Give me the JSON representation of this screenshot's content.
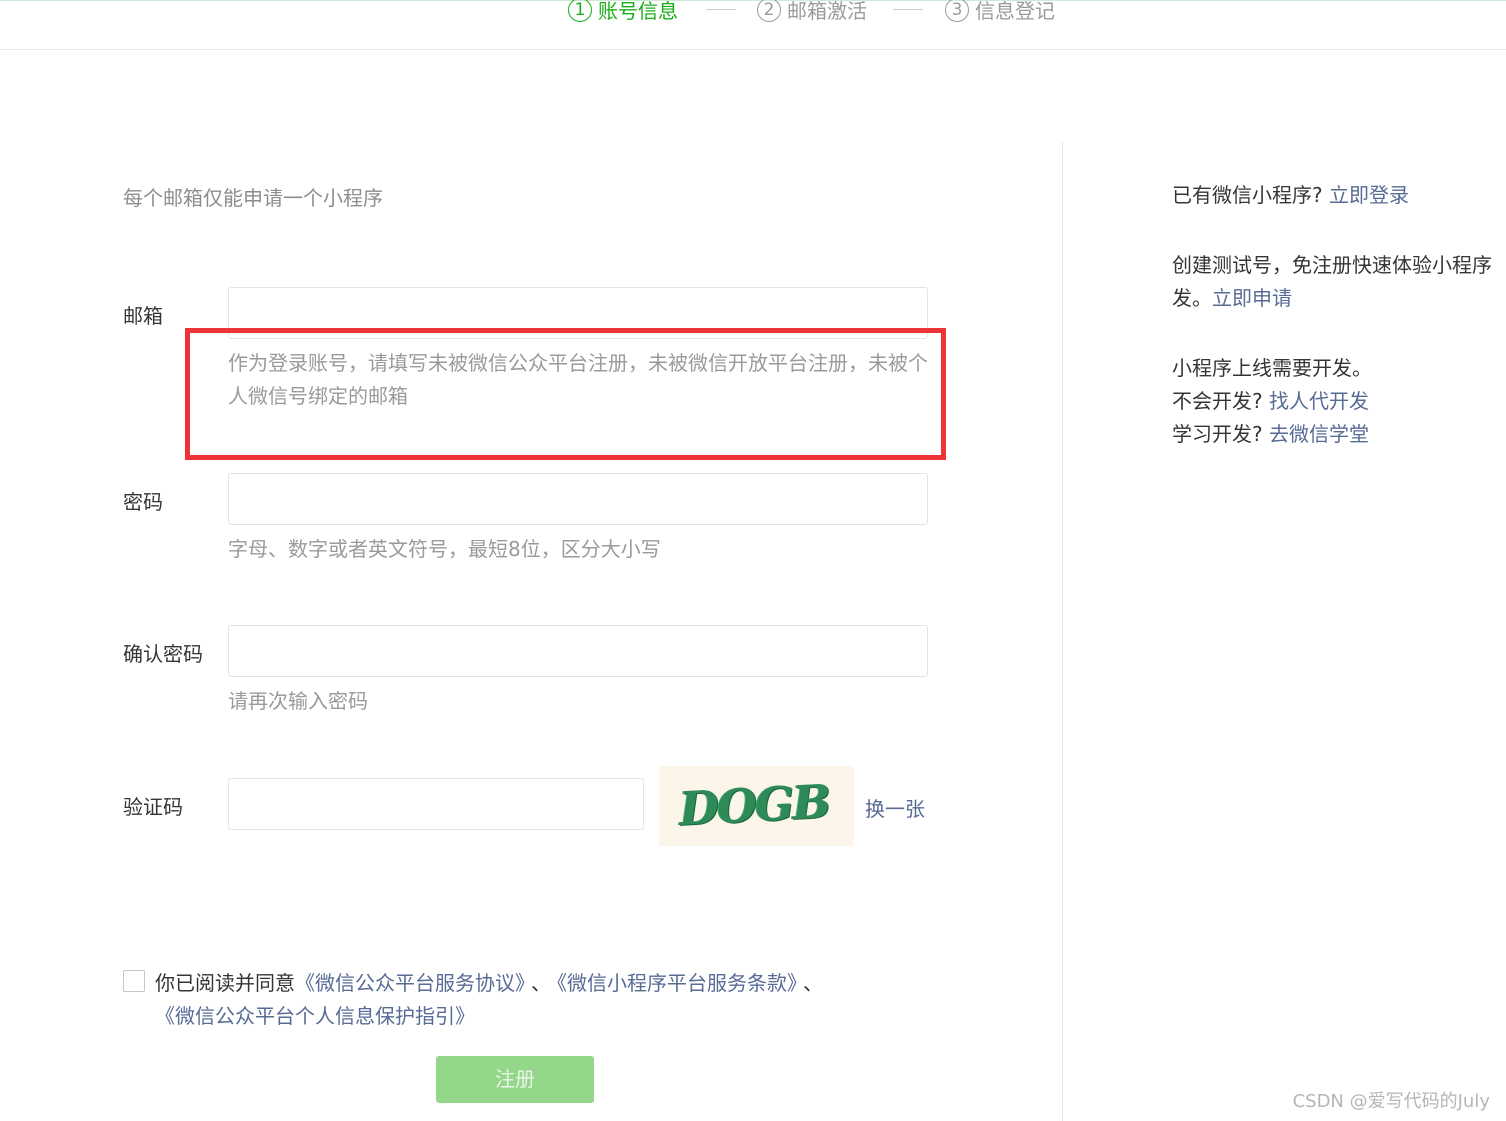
{
  "steps": [
    {
      "num": "1",
      "label": "账号信息"
    },
    {
      "num": "2",
      "label": "邮箱激活"
    },
    {
      "num": "3",
      "label": "信息登记"
    }
  ],
  "form": {
    "top_tip": "每个邮箱仅能申请一个小程序",
    "email": {
      "label": "邮箱",
      "value": "",
      "hint": "作为登录账号，请填写未被微信公众平台注册，未被微信开放平台注册，未被个人微信号绑定的邮箱"
    },
    "password": {
      "label": "密码",
      "value": "",
      "hint": "字母、数字或者英文符号，最短8位，区分大小写"
    },
    "confirm_password": {
      "label": "确认密码",
      "value": "",
      "hint": "请再次输入密码"
    },
    "captcha": {
      "label": "验证码",
      "value": "",
      "image_text": "DOGB",
      "refresh_label": "换一张"
    },
    "agreement": {
      "prefix": "你已阅读并同意",
      "link1": "《微信公众平台服务协议》",
      "separator": "、",
      "link2": "《微信小程序平台服务条款》",
      "trailing": "、",
      "link3": "《微信公众平台个人信息保护指引》",
      "checked": false
    },
    "submit_label": "注册"
  },
  "side": {
    "login_prompt": "已有微信小程序?",
    "login_link": "立即登录",
    "test_line1": "创建测试号，免注册快速体验小程序",
    "test_line2_prefix": "发。",
    "test_link": "立即申请",
    "dev_line": "小程序上线需要开发。",
    "dev_prompt": "不会开发?",
    "dev_link": "找人代开发",
    "learn_prompt": "学习开发?",
    "learn_link": "去微信学堂"
  },
  "watermark": "CSDN @爱写代码的July",
  "colors": {
    "accent": "#1aad19",
    "link": "#576b95",
    "highlight": "#ee3338",
    "button_disabled": "#94d68a"
  }
}
